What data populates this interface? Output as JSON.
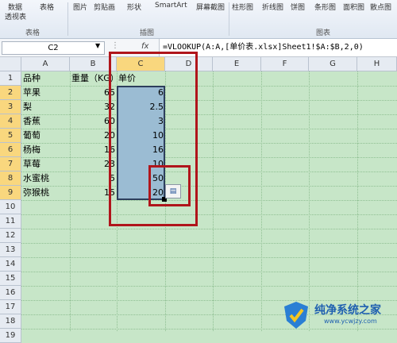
{
  "ribbon": {
    "items": [
      "数据",
      "表格",
      "图片",
      "剪贴画",
      "形状",
      "SmartArt",
      "屏幕截图",
      "柱形图",
      "折线图",
      "饼图",
      "条形图",
      "面积图",
      "散点图"
    ],
    "sub": [
      "透视表"
    ],
    "groups": [
      "表格",
      "插图",
      "图表"
    ]
  },
  "formula_bar": {
    "name_box": "C2",
    "fx": "fx",
    "formula": "=VLOOKUP(A:A,[单价表.xlsx]Sheet1!$A:$B,2,0)"
  },
  "sheet": {
    "columns": [
      "A",
      "B",
      "C",
      "D",
      "E",
      "F",
      "G",
      "H"
    ],
    "rows": [
      "1",
      "2",
      "3",
      "4",
      "5",
      "6",
      "7",
      "8",
      "9",
      "10",
      "11",
      "12",
      "13",
      "14",
      "15",
      "16",
      "17",
      "18",
      "19"
    ],
    "header_row": [
      "品种",
      "重量（KG）",
      "单价"
    ],
    "data": [
      [
        "苹果",
        "65",
        "6"
      ],
      [
        "梨",
        "32",
        "2.5"
      ],
      [
        "香蕉",
        "60",
        "3"
      ],
      [
        "葡萄",
        "20",
        "10"
      ],
      [
        "杨梅",
        "16",
        "16"
      ],
      [
        "草莓",
        "23",
        "10"
      ],
      [
        "水蜜桃",
        "5",
        "50"
      ],
      [
        "弥猴桃",
        "15",
        "20"
      ]
    ]
  },
  "watermark": {
    "title": "纯净系统之家",
    "url": "www.ycwjzy.com"
  }
}
